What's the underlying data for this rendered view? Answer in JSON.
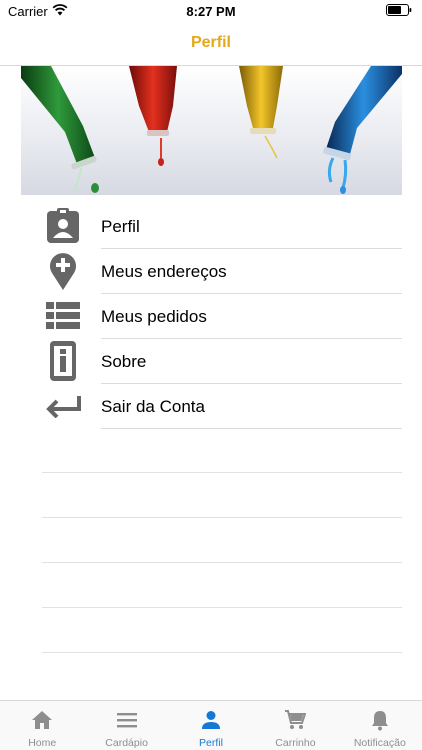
{
  "status_bar": {
    "carrier": "Carrier",
    "time": "8:27 PM"
  },
  "nav": {
    "title": "Perfil"
  },
  "menu": [
    {
      "label": "Perfil",
      "icon": "profile-badge-icon"
    },
    {
      "label": "Meus endereços",
      "icon": "map-pin-plus-icon"
    },
    {
      "label": "Meus pedidos",
      "icon": "list-icon"
    },
    {
      "label": "Sobre",
      "icon": "info-icon"
    },
    {
      "label": "Sair da Conta",
      "icon": "return-arrow-icon"
    }
  ],
  "tabs": [
    {
      "label": "Home",
      "icon": "home-icon",
      "active": false
    },
    {
      "label": "Cardápio",
      "icon": "menu-lines-icon",
      "active": false
    },
    {
      "label": "Perfil",
      "icon": "person-icon",
      "active": true
    },
    {
      "label": "Carrinho",
      "icon": "cart-icon",
      "active": false
    },
    {
      "label": "Notificação",
      "icon": "bell-icon",
      "active": false
    }
  ],
  "colors": {
    "accent": "#e3a81e",
    "tab_active": "#1678d6",
    "tab_inactive": "#8e8e8e",
    "icon_gray": "#666666"
  }
}
